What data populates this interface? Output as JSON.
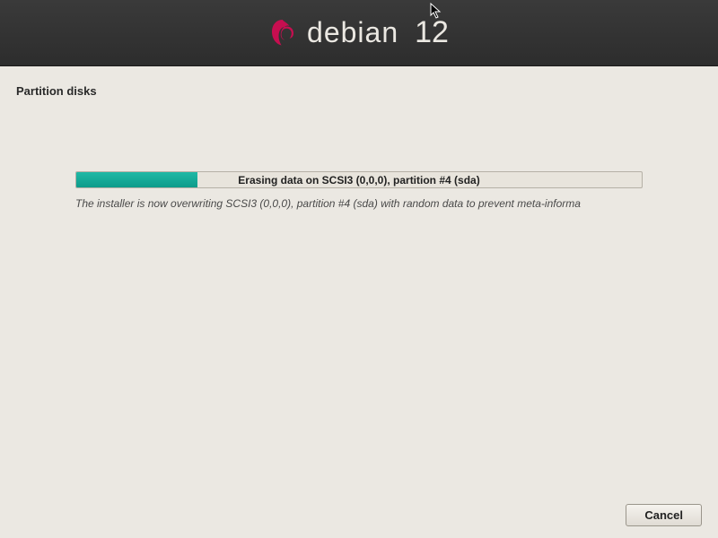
{
  "header": {
    "distro_name": "debian",
    "version": "12"
  },
  "page": {
    "title": "Partition disks"
  },
  "progress": {
    "label": "Erasing data on SCSI3 (0,0,0), partition #4 (sda)",
    "percent": 21.5,
    "status": "The installer is now overwriting SCSI3 (0,0,0), partition #4 (sda) with random data to prevent meta-informa"
  },
  "buttons": {
    "cancel": "Cancel"
  },
  "colors": {
    "accent": "#1fb9a6",
    "header_bg": "#2d2d2d",
    "page_bg": "#ebe8e2"
  }
}
